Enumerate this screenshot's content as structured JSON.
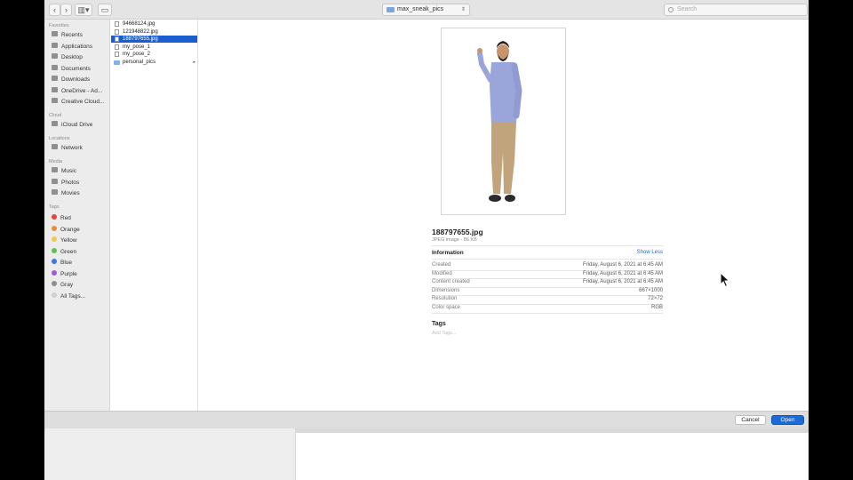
{
  "toolbar": {
    "back_icon": "chevron-left-icon",
    "forward_icon": "chevron-right-icon",
    "view_icon": "column-view-icon",
    "new_folder_icon": "new-folder-icon",
    "location": "max_sneak_pics",
    "search_placeholder": "Search"
  },
  "sidebar": {
    "favorites_header": "Favorites",
    "favorites": [
      {
        "label": "Recents",
        "icon": "clock-icon"
      },
      {
        "label": "Applications",
        "icon": "applications-icon"
      },
      {
        "label": "Desktop",
        "icon": "desktop-icon"
      },
      {
        "label": "Documents",
        "icon": "documents-icon"
      },
      {
        "label": "Downloads",
        "icon": "downloads-icon"
      },
      {
        "label": "OneDrive - Ad...",
        "icon": "folder-icon"
      },
      {
        "label": "Creative Cloud...",
        "icon": "folder-icon"
      }
    ],
    "cloud_header": "Cloud",
    "cloud": [
      {
        "label": "iCloud Drive",
        "icon": "cloud-icon"
      }
    ],
    "locations_header": "Locations",
    "locations": [
      {
        "label": "Network",
        "icon": "globe-icon"
      }
    ],
    "media_header": "Media",
    "media": [
      {
        "label": "Music",
        "icon": "music-icon"
      },
      {
        "label": "Photos",
        "icon": "photos-icon"
      },
      {
        "label": "Movies",
        "icon": "movies-icon"
      }
    ],
    "tags_header": "Tags",
    "tags": [
      {
        "label": "Red",
        "color": "#e0483e"
      },
      {
        "label": "Orange",
        "color": "#ee8a3a"
      },
      {
        "label": "Yellow",
        "color": "#f3c84a"
      },
      {
        "label": "Green",
        "color": "#63c050"
      },
      {
        "label": "Blue",
        "color": "#3b78e7"
      },
      {
        "label": "Purple",
        "color": "#a25ad0"
      },
      {
        "label": "Gray",
        "color": "#8e8e93"
      },
      {
        "label": "All Tags...",
        "color": "#d0d0d0"
      }
    ]
  },
  "files": [
    {
      "name": "94668124.jpg",
      "type": "image",
      "selected": false
    },
    {
      "name": "121948822.jpg",
      "type": "image",
      "selected": false
    },
    {
      "name": "188797655.jpg",
      "type": "image",
      "selected": true
    },
    {
      "name": "my_pose_1",
      "type": "image",
      "selected": false
    },
    {
      "name": "my_pose_2",
      "type": "image",
      "selected": false
    },
    {
      "name": "personal_pics",
      "type": "folder",
      "selected": false
    }
  ],
  "preview": {
    "file_name": "188797655.jpg",
    "file_kind": "JPEG image - 86 KB",
    "info_header": "Information",
    "show_less": "Show Less",
    "info_rows": [
      {
        "label": "Created",
        "value": "Friday, August 6, 2021 at 6:45 AM"
      },
      {
        "label": "Modified",
        "value": "Friday, August 6, 2021 at 6:45 AM"
      },
      {
        "label": "Content created",
        "value": "Friday, August 6, 2021 at 6:45 AM"
      },
      {
        "label": "Dimensions",
        "value": "667×1000"
      },
      {
        "label": "Resolution",
        "value": "72×72"
      },
      {
        "label": "Color space",
        "value": "RGB"
      }
    ],
    "tags_header": "Tags",
    "add_tags_placeholder": "Add Tags..."
  },
  "buttons": {
    "cancel": "Cancel",
    "open": "Open"
  }
}
